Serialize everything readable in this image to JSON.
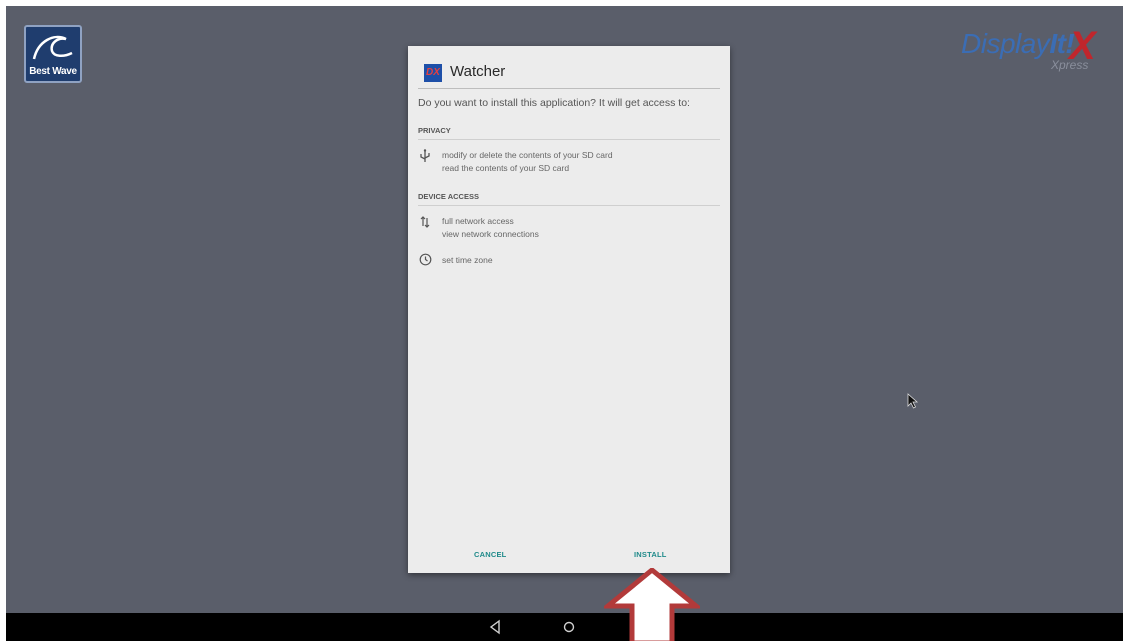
{
  "branding": {
    "left_logo_text": "Best Wave",
    "right_logo_word_1": "Display",
    "right_logo_word_2": "It!",
    "right_logo_mark": "X",
    "right_logo_sub": "Xpress"
  },
  "dialog": {
    "app_icon_text": "DX",
    "app_name": "Watcher",
    "question": "Do you want to install this application? It will get access to:",
    "sections": [
      {
        "title": "PRIVACY",
        "permissions": [
          {
            "icon": "usb-icon",
            "lines": [
              "modify or delete the contents of your SD card",
              "read the contents of your SD card"
            ]
          }
        ]
      },
      {
        "title": "DEVICE ACCESS",
        "permissions": [
          {
            "icon": "network-arrows-icon",
            "lines": [
              "full network access",
              "view network connections"
            ]
          },
          {
            "icon": "clock-icon",
            "lines": [
              "set time zone"
            ]
          }
        ]
      }
    ],
    "cancel_label": "CANCEL",
    "install_label": "INSTALL"
  },
  "navbar": {
    "back_icon": "back-triangle-icon",
    "home_icon": "home-circle-icon"
  },
  "colors": {
    "background": "#5a5e6a",
    "dialog": "#ececec",
    "button_text": "#1f8a8a",
    "arrow_border": "#b23a3a"
  }
}
